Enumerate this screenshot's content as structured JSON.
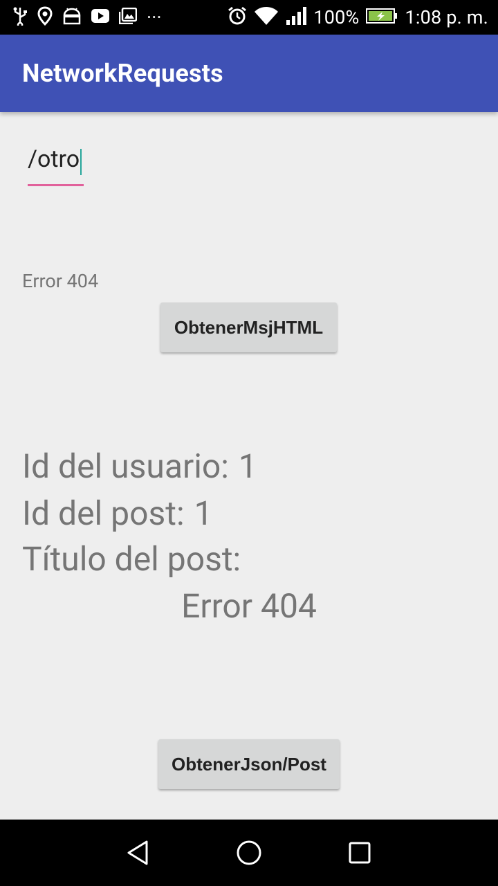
{
  "status_bar": {
    "battery_percent": "100%",
    "time": "1:08 p. m.",
    "overflow": "···"
  },
  "app_bar": {
    "title": "NetworkRequests"
  },
  "path_input": {
    "value": "/otro"
  },
  "html_result": {
    "text": "Error 404"
  },
  "buttons": {
    "get_html": "ObtenerMsjHTML",
    "get_json": "ObtenerJson/Post"
  },
  "post_info": {
    "user_id_label": "Id del usuario:",
    "user_id_value": "1",
    "post_id_label": "Id del post:",
    "post_id_value": "1",
    "title_label": "Título del post:",
    "title_value": "Error 404"
  }
}
